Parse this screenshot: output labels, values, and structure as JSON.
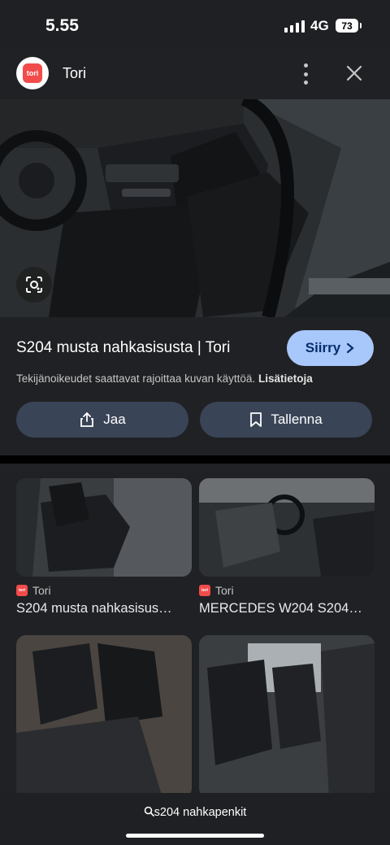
{
  "status": {
    "time": "5.55",
    "network": "4G",
    "battery": "73"
  },
  "header": {
    "site_name": "Tori",
    "logo_text": "tori"
  },
  "preview": {
    "title": "S204 musta nahkasisusta | Tori",
    "visit_label": "Siirry",
    "copyright_text": "Tekijänoikeudet saattavat rajoittaa kuvan käyttöä.",
    "learn_more": "Lisätietoja",
    "share_label": "Jaa",
    "save_label": "Tallenna"
  },
  "results": [
    {
      "source": "Tori",
      "title": "S204 musta nahkasisus…"
    },
    {
      "source": "Tori",
      "title": "MERCEDES W204 S204…"
    },
    {
      "source": "",
      "title": ""
    },
    {
      "source": "",
      "title": ""
    }
  ],
  "bottom": {
    "query": "s204 nahkapenkit"
  },
  "colors": {
    "accent": "#a8c7fa",
    "button_bg": "#394457",
    "tori_red": "#f24b4b"
  }
}
